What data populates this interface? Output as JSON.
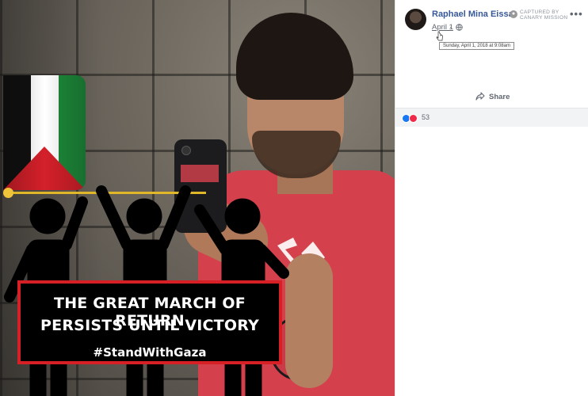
{
  "post": {
    "author": "Raphael Mina Eissa",
    "captured_by": "CAPTURED BY CANARY MISSION",
    "date_link": "April 1",
    "date_separator": "·",
    "tooltip": "Sunday, April 1, 2018 at 9:08am",
    "more_icon": "more-horizontal-icon",
    "globe_icon": "globe-icon"
  },
  "actions": {
    "share_label": "Share",
    "share_icon": "share-arrow-icon"
  },
  "reactions": {
    "count": "53",
    "types": [
      "like",
      "love"
    ],
    "colors": {
      "like": "#1877f2",
      "love": "#f0284a"
    }
  },
  "image": {
    "banner_line1": "THE GREAT MARCH OF RETURN",
    "banner_line2": "PERSISTS UNTIL VICTORY",
    "hashtag": "#StandWithGaza",
    "flag_colors": {
      "black": "#111111",
      "white": "#ffffff",
      "green": "#1d8a3a",
      "red": "#d4202a"
    },
    "banner_border_color": "#d71f26",
    "line_color": "#e1b72a",
    "shirt_color": "#d4414d"
  },
  "colors": {
    "author_link": "#385898",
    "meta_text": "#616770",
    "reaction_bar": "#f2f3f5"
  }
}
